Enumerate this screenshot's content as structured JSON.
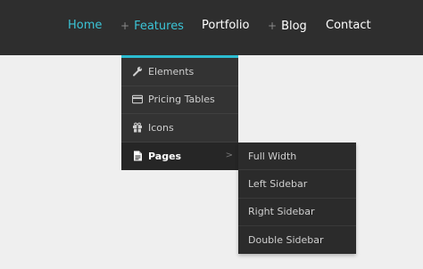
{
  "nav": {
    "items": [
      {
        "label": "Home",
        "plus": ""
      },
      {
        "label": "Features",
        "plus": "+"
      },
      {
        "label": "Portfolio",
        "plus": ""
      },
      {
        "label": "Blog",
        "plus": "+"
      },
      {
        "label": "Contact",
        "plus": ""
      }
    ],
    "active_color": "#3bc4d6"
  },
  "dropdown": {
    "accent": "#2bbcd1",
    "items": [
      {
        "label": "Elements",
        "icon": "wrench-icon"
      },
      {
        "label": "Pricing Tables",
        "icon": "credit-card-icon"
      },
      {
        "label": "Icons",
        "icon": "gift-icon"
      },
      {
        "label": "Pages",
        "icon": "document-icon",
        "arrow": ">"
      }
    ]
  },
  "submenu": {
    "items": [
      {
        "label": "Full Width"
      },
      {
        "label": "Left Sidebar"
      },
      {
        "label": "Right Sidebar"
      },
      {
        "label": "Double Sidebar"
      }
    ]
  }
}
